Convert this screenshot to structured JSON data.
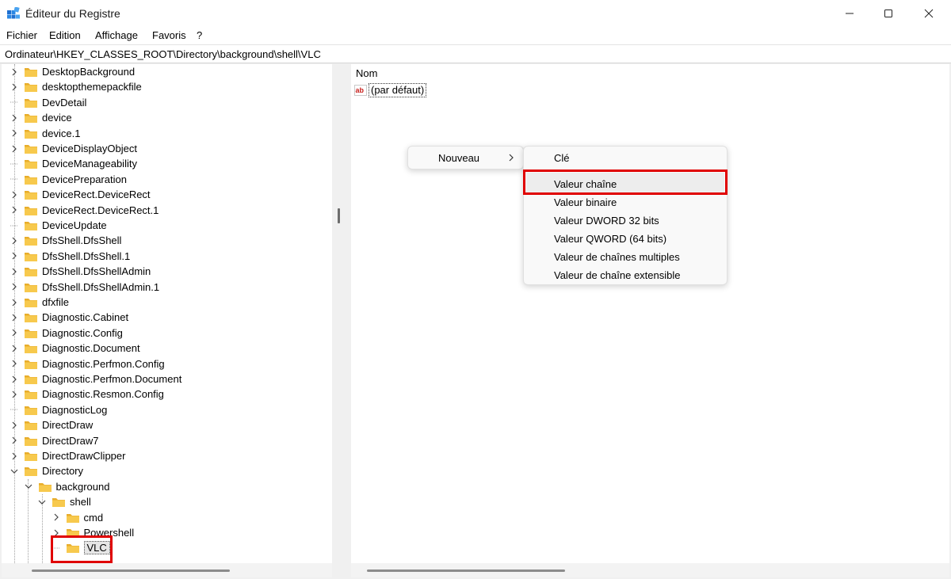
{
  "window": {
    "title": "Éditeur du Registre"
  },
  "menu": [
    "Fichier",
    "Edition",
    "Affichage",
    "Favoris",
    "?"
  ],
  "address": "Ordinateur\\HKEY_CLASSES_ROOT\\Directory\\background\\shell\\VLC",
  "tree": {
    "items": [
      {
        "label": "DesktopBackground",
        "expanded": false
      },
      {
        "label": "desktopthemepackfile",
        "expanded": false
      },
      {
        "label": "DevDetail",
        "expanded": null
      },
      {
        "label": "device",
        "expanded": false
      },
      {
        "label": "device.1",
        "expanded": false
      },
      {
        "label": "DeviceDisplayObject",
        "expanded": false
      },
      {
        "label": "DeviceManageability",
        "expanded": null
      },
      {
        "label": "DevicePreparation",
        "expanded": null
      },
      {
        "label": "DeviceRect.DeviceRect",
        "expanded": false
      },
      {
        "label": "DeviceRect.DeviceRect.1",
        "expanded": false
      },
      {
        "label": "DeviceUpdate",
        "expanded": null
      },
      {
        "label": "DfsShell.DfsShell",
        "expanded": false
      },
      {
        "label": "DfsShell.DfsShell.1",
        "expanded": false
      },
      {
        "label": "DfsShell.DfsShellAdmin",
        "expanded": false
      },
      {
        "label": "DfsShell.DfsShellAdmin.1",
        "expanded": false
      },
      {
        "label": "dfxfile",
        "expanded": false
      },
      {
        "label": "Diagnostic.Cabinet",
        "expanded": false
      },
      {
        "label": "Diagnostic.Config",
        "expanded": false
      },
      {
        "label": "Diagnostic.Document",
        "expanded": false
      },
      {
        "label": "Diagnostic.Perfmon.Config",
        "expanded": false
      },
      {
        "label": "Diagnostic.Perfmon.Document",
        "expanded": false
      },
      {
        "label": "Diagnostic.Resmon.Config",
        "expanded": false
      },
      {
        "label": "DiagnosticLog",
        "expanded": null
      },
      {
        "label": "DirectDraw",
        "expanded": false
      },
      {
        "label": "DirectDraw7",
        "expanded": false
      },
      {
        "label": "DirectDrawClipper",
        "expanded": false
      },
      {
        "label": "Directory",
        "expanded": true
      },
      {
        "label": "background",
        "expanded": true
      },
      {
        "label": "shell",
        "expanded": true
      },
      {
        "label": "cmd",
        "expanded": false
      },
      {
        "label": "Powershell",
        "expanded": false
      },
      {
        "label": "VLC",
        "expanded": null,
        "selected": true
      }
    ]
  },
  "list": {
    "column_name": "Nom",
    "default_value": "(par défaut)"
  },
  "context_menu": {
    "nouveau_label": "Nouveau",
    "submenu": [
      "Clé",
      "Valeur chaîne",
      "Valeur binaire",
      "Valeur DWORD 32 bits",
      "Valeur QWORD (64 bits)",
      "Valeur de chaînes multiples",
      "Valeur de chaîne extensible"
    ]
  },
  "colors": {
    "highlight": "#e00000",
    "folder": "#f7c94d",
    "folder_dark": "#e8ad2b"
  }
}
